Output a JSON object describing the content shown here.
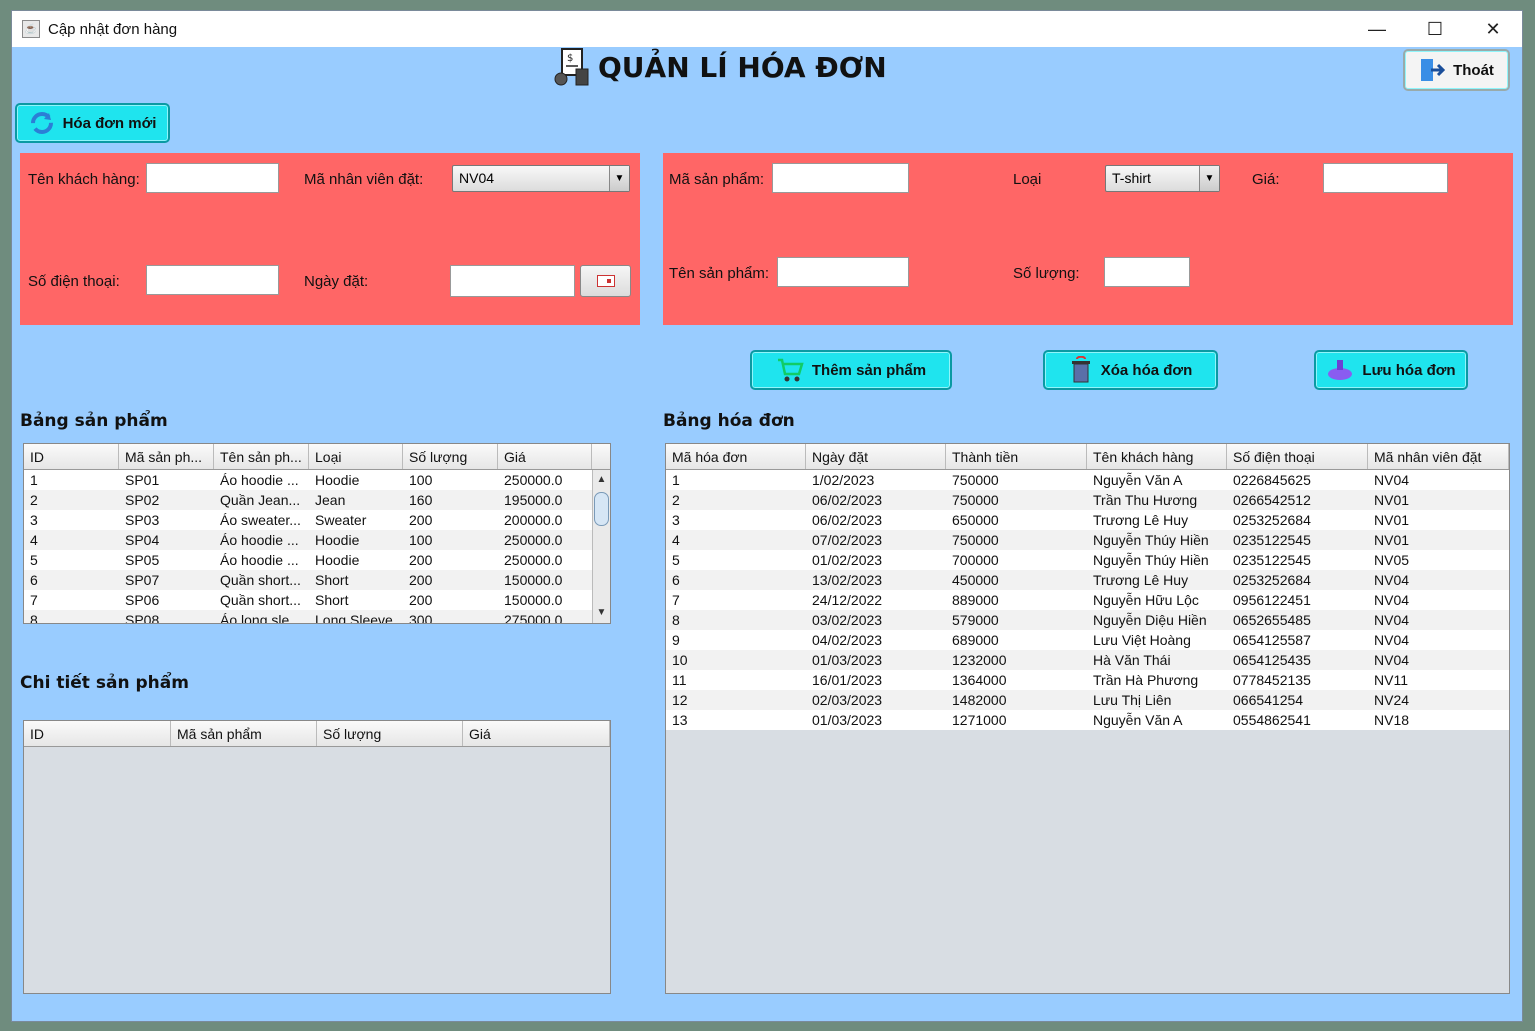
{
  "window": {
    "title": "Cập nhật đơn hàng"
  },
  "header": {
    "title": "QUẢN LÍ HÓA ĐƠN"
  },
  "buttons": {
    "exit": "Thoát",
    "new_invoice": "Hóa đơn mới",
    "add_product": "Thêm sản phẩm",
    "delete_invoice": "Xóa hóa đơn",
    "save_invoice": "Lưu hóa đơn"
  },
  "customer_form": {
    "customer_name_label": "Tên khách hàng:",
    "customer_name_value": "",
    "employee_label": "Mã nhân viên đặt:",
    "employee_value": "NV04",
    "phone_label": "Số điện thoại:",
    "phone_value": "",
    "date_label": "Ngày đặt:",
    "date_value": ""
  },
  "product_form": {
    "product_code_label": "Mã sản phẩm:",
    "product_code_value": "",
    "type_label": "Loại",
    "type_value": "T-shirt",
    "price_label": "Giá:",
    "price_value": "",
    "product_name_label": "Tên sản phẩm:",
    "product_name_value": "",
    "quantity_label": "Số lượng:",
    "quantity_value": ""
  },
  "products_table": {
    "title": "Bảng sản phẩm",
    "columns": [
      "ID",
      "Mã sản ph...",
      "Tên sản ph...",
      "Loại",
      "Số lượng",
      "Giá"
    ],
    "rows": [
      [
        "1",
        "SP01",
        "Áo hoodie ...",
        "Hoodie",
        "100",
        "250000.0"
      ],
      [
        "2",
        "SP02",
        "Quần Jean...",
        "Jean",
        "160",
        "195000.0"
      ],
      [
        "3",
        "SP03",
        "Áo sweater...",
        "Sweater",
        "200",
        "200000.0"
      ],
      [
        "4",
        "SP04",
        "Áo hoodie ...",
        "Hoodie",
        "100",
        "250000.0"
      ],
      [
        "5",
        "SP05",
        "Áo hoodie ...",
        "Hoodie",
        "200",
        "250000.0"
      ],
      [
        "6",
        "SP07",
        "Quần short...",
        "Short",
        "200",
        "150000.0"
      ],
      [
        "7",
        "SP06",
        "Quần short...",
        "Short",
        "200",
        "150000.0"
      ],
      [
        "8",
        "SP08",
        "Áo long sle...",
        "Long Sleeve",
        "300",
        "275000.0"
      ]
    ]
  },
  "details_table": {
    "title": "Chi tiết sản phẩm",
    "columns": [
      "ID",
      "Mã sản phẩm",
      "Số lượng",
      "Giá"
    ]
  },
  "invoices_table": {
    "title": "Bảng hóa đơn",
    "columns": [
      "Mã hóa đơn",
      "Ngày đặt",
      "Thành tiền",
      "Tên khách hàng",
      "Số điện thoại",
      "Mã nhân viên đặt"
    ],
    "rows": [
      [
        "1",
        "1/02/2023",
        "750000",
        "Nguyễn Văn A",
        "0226845625",
        "NV04"
      ],
      [
        "2",
        "06/02/2023",
        "750000",
        "Trần Thu Hương",
        "0266542512",
        "NV01"
      ],
      [
        "3",
        "06/02/2023",
        "650000",
        "Trương Lê Huy",
        "0253252684",
        "NV01"
      ],
      [
        "4",
        "07/02/2023",
        "750000",
        "Nguyễn Thúy Hiền",
        "0235122545",
        "NV01"
      ],
      [
        "5",
        "01/02/2023",
        "700000",
        "Nguyễn Thúy Hiền",
        "0235122545",
        "NV05"
      ],
      [
        "6",
        "13/02/2023",
        "450000",
        "Trương Lê Huy",
        "0253252684",
        "NV04"
      ],
      [
        "7",
        "24/12/2022",
        "889000",
        "Nguyễn Hữu Lộc",
        "0956122451",
        "NV04"
      ],
      [
        "8",
        "03/02/2023",
        "579000",
        "Nguyễn Diệu Hiền",
        "0652655485",
        "NV04"
      ],
      [
        "9",
        "04/02/2023",
        "689000",
        "Lưu Việt Hoàng",
        "0654125587",
        "NV04"
      ],
      [
        "10",
        "01/03/2023",
        "1232000",
        "Hà Văn Thái",
        "0654125435",
        "NV04"
      ],
      [
        "11",
        "16/01/2023",
        "1364000",
        "Trần Hà Phương",
        "0778452135",
        "NV11"
      ],
      [
        "12",
        "02/03/2023",
        "1482000",
        "Lưu Thị Liên",
        "066541254",
        "NV24"
      ],
      [
        "13",
        "01/03/2023",
        "1271000",
        "Nguyễn Văn A",
        "0554862541",
        "NV18"
      ]
    ]
  },
  "icons": {
    "window_controls": [
      "minimize-icon",
      "maximize-icon",
      "close-icon"
    ]
  },
  "colors": {
    "background": "#99ccff",
    "form_panel": "#ff6666",
    "button": "#1fe4ee"
  }
}
